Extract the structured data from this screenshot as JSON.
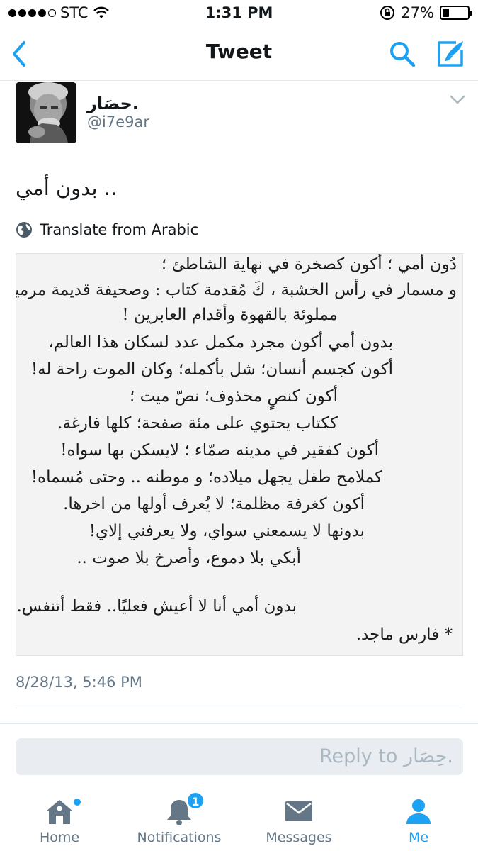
{
  "status_bar": {
    "carrier": "STC",
    "time": "1:31 PM",
    "battery_percent_label": "27%",
    "battery_level": 0.27
  },
  "nav": {
    "title": "Tweet",
    "accent_color": "#1da1f2"
  },
  "tweet": {
    "display_name": "حصَار.",
    "handle": "@i7e9ar",
    "text": ".. بدون أمي",
    "translate_label": "Translate from Arabic",
    "timestamp": "8/28/13, 5:46 PM",
    "poem_lines": [
      "دُون أمي ؛ أكون كصخرة في نهاية الشاطئ ؛",
      "و مسمار في رأس الخشبة ، كَ مُقدمة كتاب : وصحيفة قديمة مرمية ؛",
      "مملوئة بالقهوة وأقدام العابرين !",
      "بدون أمي أكون مجرد مكمل عدد لسكان هذا العالم،",
      "أكون كجسم أنسان؛ شل بأكمله؛ وكان الموت راحة له!",
      "أكون كنصٍ محذوف؛ نصّ ميت ؛",
      "ككتاب يحتوي على مئة صفحة؛ كلها فارغة.",
      "أكون كفقير في مدينه صمّاء ؛ لايسكن بها سواه!",
      "كملامح طفل يجهل ميلاده؛ و موطنه .. وحتى مُسماه!",
      "أكون كغرفة مظلمة؛ لا يُعرف أولها من اخرها.",
      "بدونها لا يسمعني سواي، ولا يعرفني إلاي!",
      "أبكي بلا دموع، وأصرخ بلا صوت ..",
      "بدون أمي أنا لا أعيش فعليًا.. فقط أتنفس.",
      "* فارس ماجد."
    ]
  },
  "reply": {
    "placeholder": "Reply to حِصَار."
  },
  "tabs": [
    {
      "label": "Home",
      "icon": "home-icon",
      "has_dot": true
    },
    {
      "label": "Notifications",
      "icon": "bell-icon",
      "badge": "1"
    },
    {
      "label": "Messages",
      "icon": "envelope-icon"
    },
    {
      "label": "Me",
      "icon": "person-icon",
      "active": true
    }
  ]
}
